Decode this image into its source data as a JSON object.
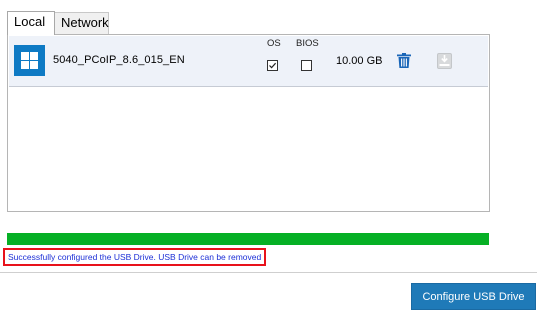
{
  "tabs": {
    "local": "Local",
    "network": "Network"
  },
  "image_row": {
    "name": "5040_PCoIP_8.6_015_EN",
    "os_header": "OS",
    "bios_header": "BIOS",
    "os_checked": true,
    "bios_checked": false,
    "size": "10.00 GB",
    "icons": {
      "logo": "windows-logo-icon",
      "delete": "trash-icon",
      "download": "download-drive-icon"
    }
  },
  "progress": {
    "percent": 100,
    "color": "#06b025"
  },
  "status": {
    "message": "Successfully configured the USB Drive. USB Drive can be removed",
    "text_color": "#1c2fd6",
    "border_color": "#e8121b"
  },
  "footer": {
    "configure_label": "Configure USB Drive",
    "button_color": "#1f7ab8"
  }
}
